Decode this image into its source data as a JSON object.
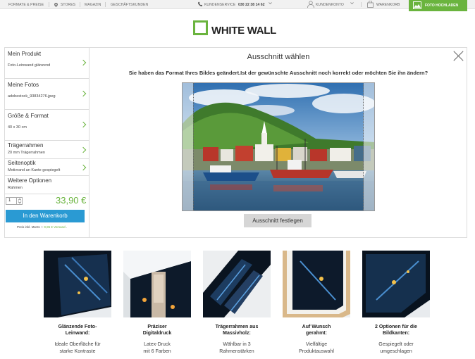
{
  "topbar": {
    "formats": "FORMATE & PREISE",
    "stores": "STORES",
    "magazine": "MAGAZIN",
    "business": "GESCHÄFTSKUNDEN",
    "service": "KUNDENSERVICE",
    "phone": "030 22 38 14 62",
    "account": "KUNDENKONTO",
    "cart": "WARENKORB",
    "upload": "FOTO HOCHLADEN"
  },
  "logo": {
    "text": "WHITE WALL"
  },
  "sidebar": {
    "items": [
      {
        "title": "Mein Produkt",
        "value": "Foto-Leinwand glänzend"
      },
      {
        "title": "Meine Fotos",
        "value": "adobestock_93834276.jpeg"
      },
      {
        "title": "Größe & Format",
        "value": "40 x 30 cm"
      },
      {
        "title": "Trägerrahmen",
        "value": "20 mm Trägerrahmen"
      },
      {
        "title": "Seitenoptik",
        "value": "Motivrand an Kante gespiegelt"
      },
      {
        "title": "Weitere Optionen",
        "value": "Rahmen"
      }
    ],
    "quantity": "1",
    "price": "33,90 €",
    "cart_button": "In den Warenkorb",
    "vat_prefix": "Preis inkl. MwSt. + ",
    "vat_link": "9,95 € Versand",
    "vat_suffix": " ."
  },
  "dialog": {
    "title": "Ausschnitt wählen",
    "question": "Sie haben das Format Ihres Bildes geändert.Ist der gewünschte Ausschnitt noch korrekt oder möchten Sie ihn ändern?",
    "confirm_button": "Ausschnitt festlegen"
  },
  "features": [
    {
      "title": "Glänzende Foto-\nLeinwand:",
      "desc": "Ideale Oberfläche für\nstarke Kontraste"
    },
    {
      "title": "Präziser\nDigitaldruck",
      "desc": "Latex-Druck\nmit 6 Farben"
    },
    {
      "title": "Trägerrahmen aus\nMassivholz:",
      "desc": "Wählbar in 3\nRahmenstärken"
    },
    {
      "title": "Auf Wunsch\ngerahmt:",
      "desc": "Vielfältige\nProduktauswahl"
    },
    {
      "title": "2 Optionen für die\nBildkanten:",
      "desc": "Gespiegelt oder\numgeschlagen"
    }
  ],
  "colors": {
    "accent": "#6ab43e",
    "button_blue": "#2a9ad3"
  }
}
